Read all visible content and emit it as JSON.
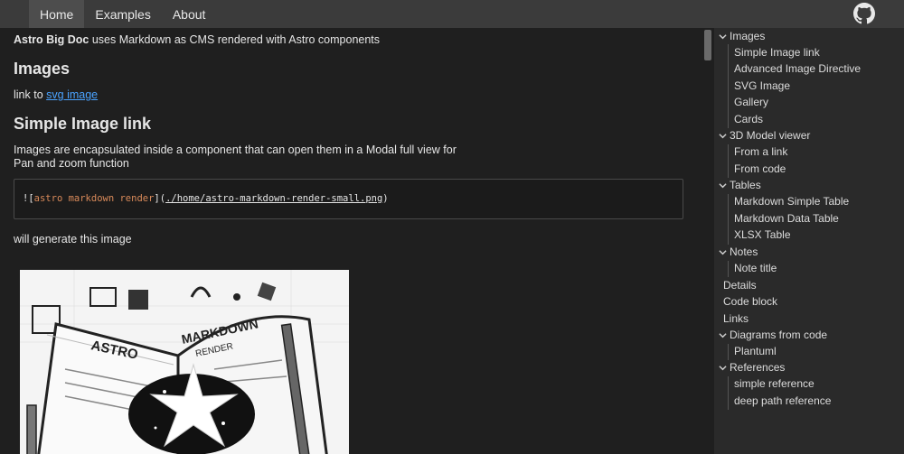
{
  "nav": {
    "items": [
      "Home",
      "Examples",
      "About"
    ],
    "active": "Home"
  },
  "content": {
    "intro_bold": "Astro Big Doc",
    "intro_rest": " uses Markdown as CMS rendered with Astro components",
    "h_images": "Images",
    "link_prefix": "link to ",
    "link_text": "svg image",
    "h_simple": "Simple Image link",
    "enc_text": "Images are encapsulated inside a component that can open them in a Modal full view for Pan and zoom function",
    "code_bang": "![",
    "code_alt": "astro markdown render",
    "code_mid": "](",
    "code_url": "./home/astro-markdown-render-small.png",
    "code_end": ")",
    "gen_text": "will generate this image",
    "image_text_left": "ASTRO",
    "image_text_right": "MARKDOWN",
    "image_text_right2": "RENDER"
  },
  "toc": {
    "images": "Images",
    "simple_image_link": "Simple Image link",
    "advanced_image_directive": "Advanced Image Directive",
    "svg_image": "SVG Image",
    "gallery": "Gallery",
    "cards": "Cards",
    "model_viewer": "3D Model viewer",
    "from_link": "From a link",
    "from_code": "From code",
    "tables": "Tables",
    "md_simple_table": "Markdown Simple Table",
    "md_data_table": "Markdown Data Table",
    "xlsx_table": "XLSX Table",
    "notes": "Notes",
    "note_title": "Note title",
    "details": "Details",
    "code_block": "Code block",
    "links": "Links",
    "diagrams": "Diagrams from code",
    "plantuml": "Plantuml",
    "references": "References",
    "simple_reference": "simple reference",
    "deep_path_reference": "deep path reference"
  },
  "icons": {
    "github": "github-icon",
    "chevron": "chevron-down-icon"
  },
  "colors": {
    "link": "#4aa3ff",
    "code_alt": "#d98a5a",
    "topbar": "#3b3b3b",
    "sidebar": "#2a2a2a"
  }
}
